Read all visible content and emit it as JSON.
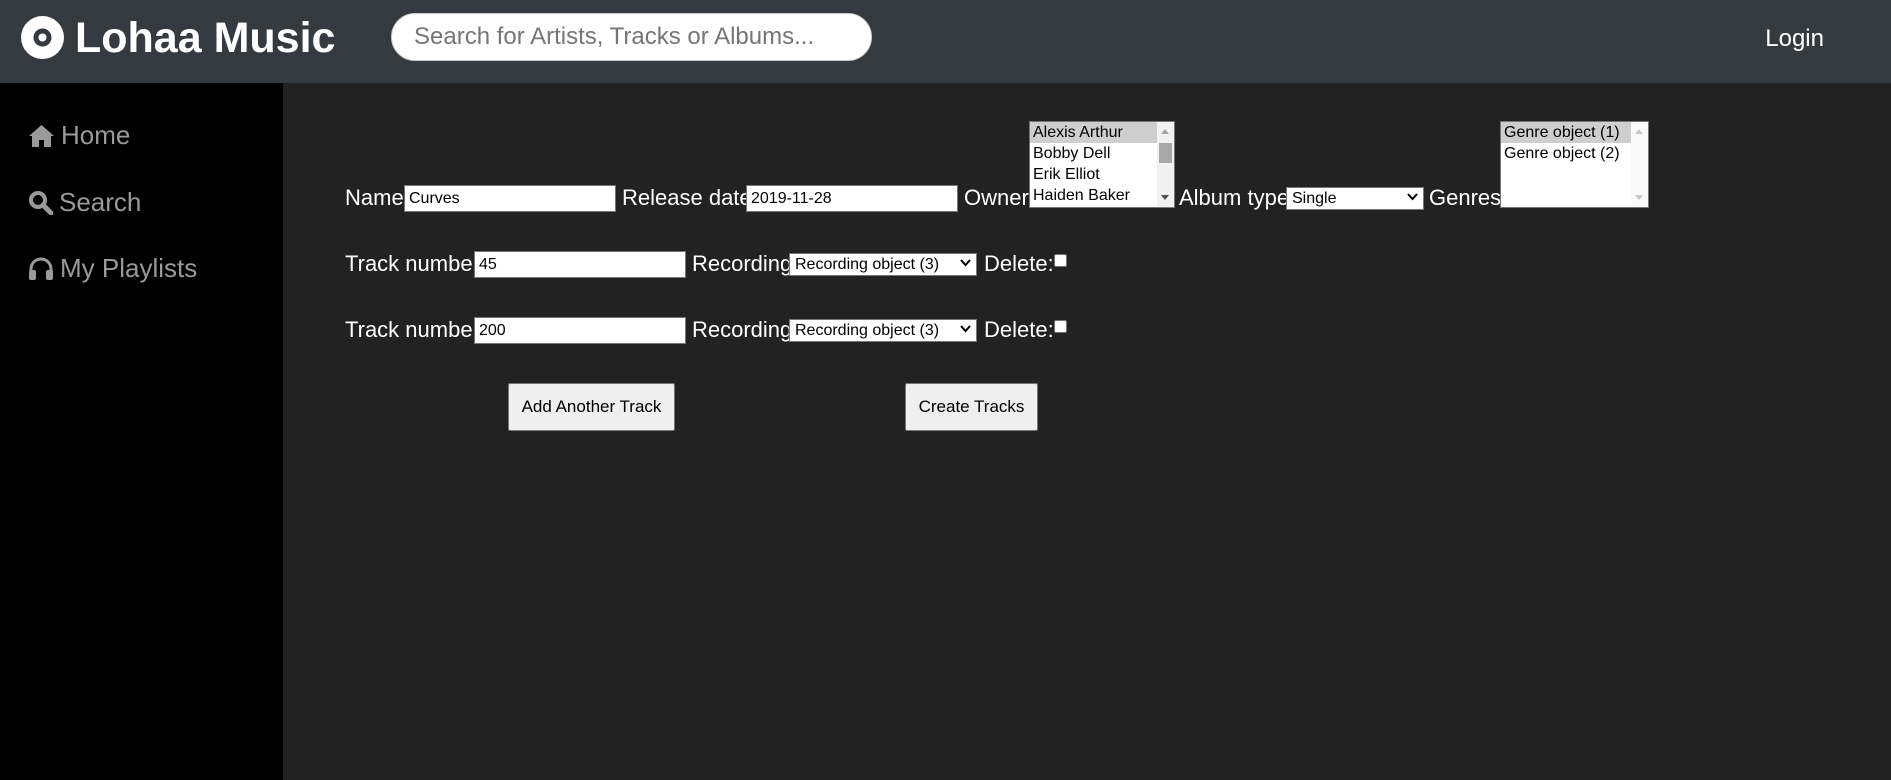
{
  "header": {
    "app_title": "Lohaa Music",
    "search_placeholder": "Search for Artists, Tracks or Albums...",
    "login_label": "Login"
  },
  "sidebar": {
    "items": [
      {
        "label": "Home",
        "icon": "home-icon"
      },
      {
        "label": "Search",
        "icon": "search-icon"
      },
      {
        "label": "My Playlists",
        "icon": "headphones-icon"
      }
    ]
  },
  "form": {
    "name_label": "Name:",
    "name_value": "Curves",
    "release_date_label": "Release date:",
    "release_date_value": "2019-11-28",
    "owner_label": "Owner:",
    "owner_options": [
      "Alexis Arthur",
      "Bobby Dell",
      "Erik Elliot",
      "Haiden Baker"
    ],
    "owner_selected": "Alexis Arthur",
    "album_type_label": "Album type:",
    "album_type_value": "Single",
    "genres_label": "Genres:",
    "genre_options": [
      "Genre object (1)",
      "Genre object (2)"
    ],
    "genre_selected": "Genre object (1)",
    "tracks": [
      {
        "track_number_label": "Track number:",
        "track_number_value": "45",
        "recording_label": "Recording:",
        "recording_value": "Recording object (3)",
        "delete_label": "Delete:",
        "delete_checked": false
      },
      {
        "track_number_label": "Track number:",
        "track_number_value": "200",
        "recording_label": "Recording:",
        "recording_value": "Recording object (3)",
        "delete_label": "Delete:",
        "delete_checked": false
      }
    ],
    "add_track_label": "Add Another Track",
    "create_tracks_label": "Create Tracks"
  },
  "colors": {
    "topbar": "#343a40",
    "sidebar": "#000000",
    "main_bg": "#222222",
    "nav_text": "#9a9a9a"
  }
}
